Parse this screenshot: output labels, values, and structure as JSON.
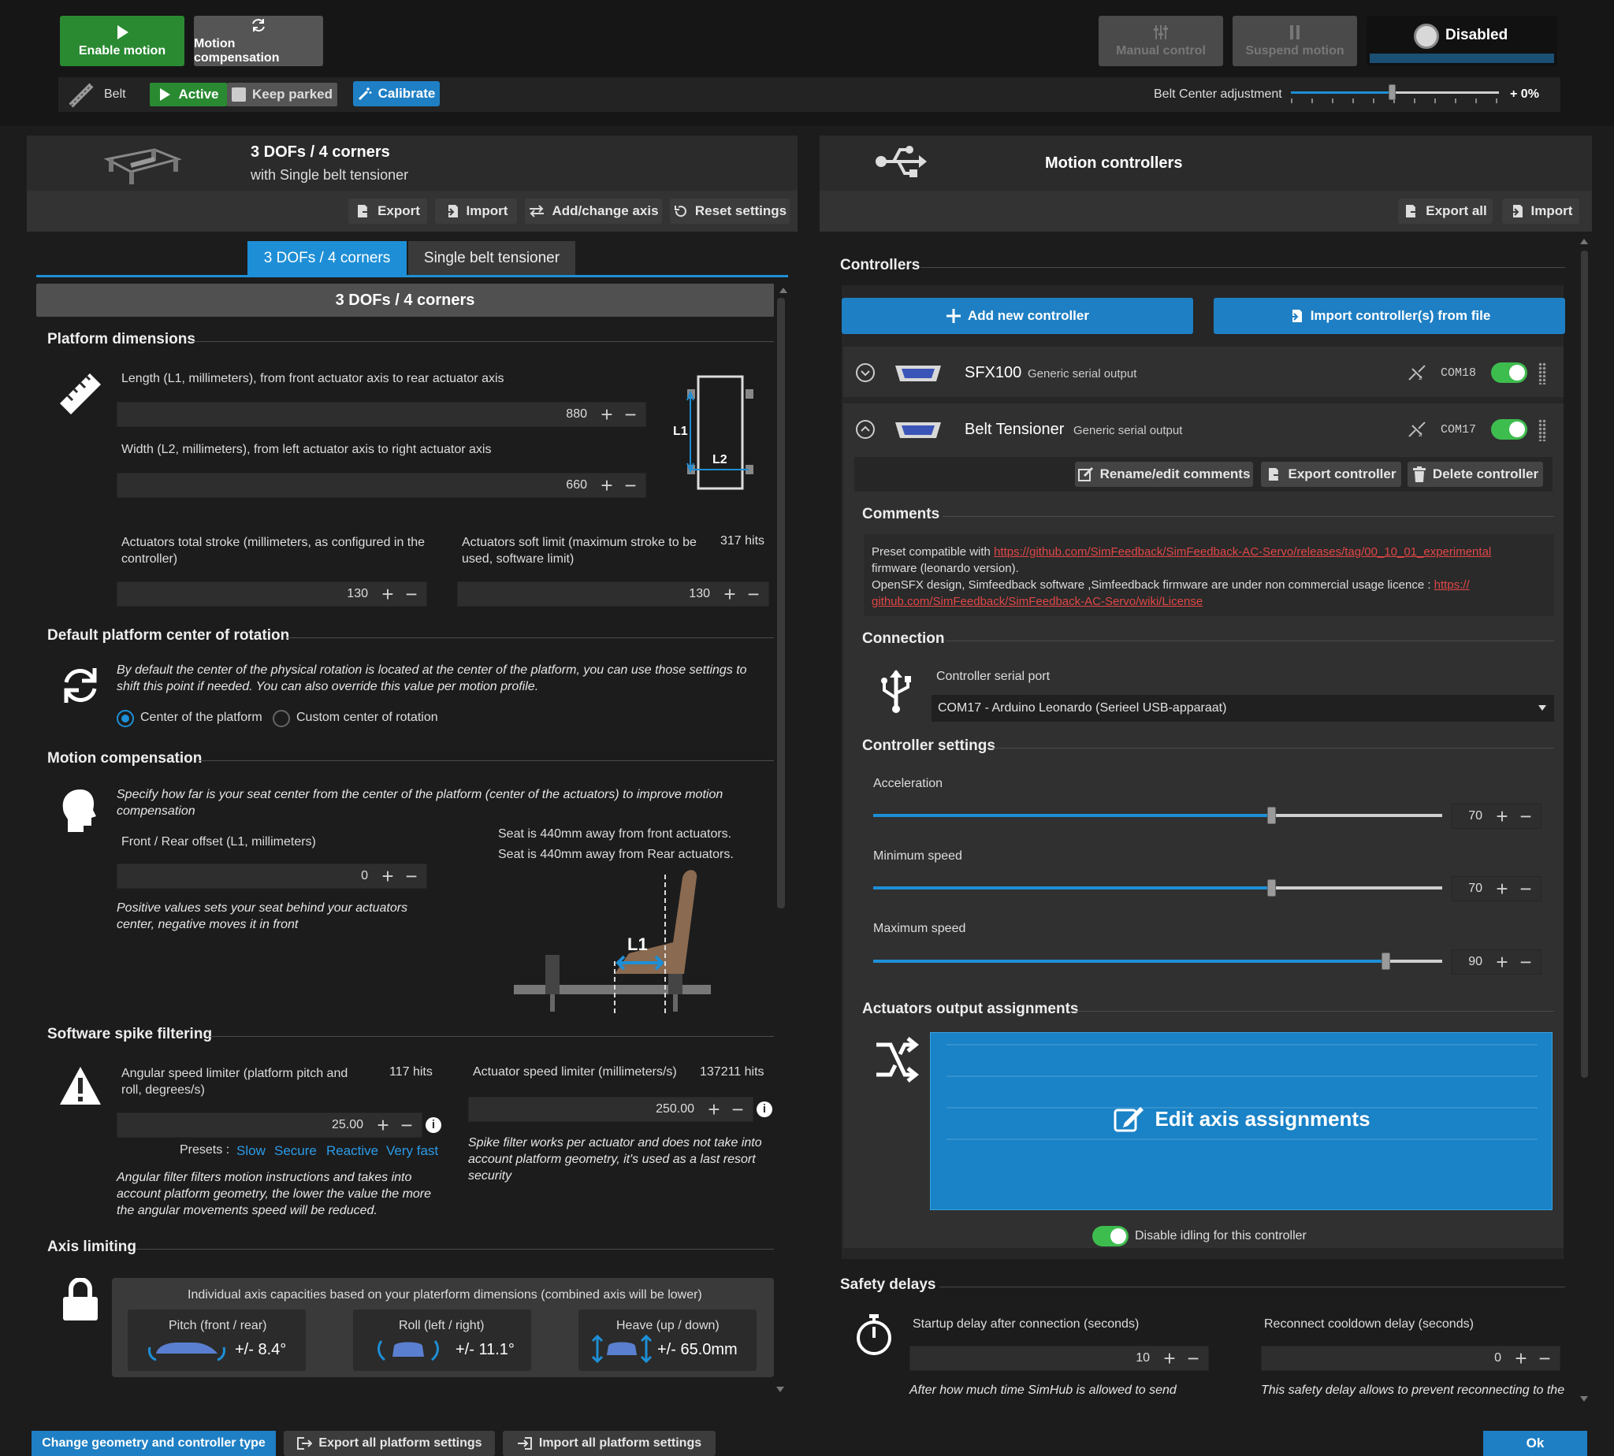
{
  "toolbar": {
    "enable_motion": "Enable motion",
    "motion_compensation": "Motion compensation",
    "manual_control": "Manual control",
    "suspend_motion": "Suspend motion",
    "disabled": "Disabled"
  },
  "belt": {
    "label": "Belt",
    "active": "Active",
    "keep_parked": "Keep parked",
    "calibrate": "Calibrate",
    "center_label": "Belt Center adjustment",
    "center_value": "+ 0%"
  },
  "left_header": {
    "title": "3 DOFs / 4 corners",
    "subtitle": "with Single belt tensioner",
    "export": "Export",
    "import": "Import",
    "add_change_axis": "Add/change axis",
    "reset_settings": "Reset settings"
  },
  "tabs": [
    "3 DOFs / 4 corners",
    "Single belt tensioner"
  ],
  "section_title": "3 DOFs / 4 corners",
  "platform": {
    "heading": "Platform dimensions",
    "length_label": "Length (L1, millimeters), from front actuator axis to rear actuator axis",
    "length_value": "880",
    "width_label": "Width (L2, millimeters), from left actuator axis to right actuator axis",
    "width_value": "660",
    "l1": "L1",
    "l2": "L2",
    "stroke_label": "Actuators total stroke (millimeters, as configured in the controller)",
    "stroke_value": "130",
    "soft_label": "Actuators soft limit (maximum stroke to be used, software limit)",
    "soft_hits": "317 hits",
    "soft_value": "130"
  },
  "rotation": {
    "heading": "Default platform center of rotation",
    "desc": "By default the center of the physical rotation is located at the center of the platform, you can use those settings to shift this point if needed. You can also override this value per motion profile.",
    "opt1": "Center of the platform",
    "opt2": "Custom center of rotation"
  },
  "motion_comp": {
    "heading": "Motion compensation",
    "desc": "Specify how far is your seat center from the center of the platform (center of the actuators) to improve motion compensation",
    "offset_label": "Front / Rear offset (L1, millimeters)",
    "offset_value": "0",
    "note": "Positive values sets your seat behind your actuators center, negative moves it in front",
    "info1": "Seat is 440mm away from front actuators.",
    "info2": "Seat is 440mm away from Rear actuators.",
    "l1": "L1"
  },
  "spike": {
    "heading": "Software spike filtering",
    "angular_label": "Angular speed limiter (platform pitch and roll, degrees/s)",
    "angular_hits": "117 hits",
    "angular_value": "25.00",
    "presets_label": "Presets :",
    "presets": [
      "Slow",
      "Secure",
      "Reactive",
      "Very fast"
    ],
    "angular_note": "Angular filter filters motion instructions and takes into account platform geometry, the lower the value the more the angular movements speed will be reduced.",
    "actuator_label": "Actuator speed limiter (millimeters/s)",
    "actuator_hits": "137211 hits",
    "actuator_value": "250.00",
    "actuator_note": "Spike filter works per actuator and does not take into account platform geometry, it's used as a last resort security"
  },
  "axis_limit": {
    "heading": "Axis limiting",
    "desc": "Individual axis capacities based on your platerform dimensions (combined axis will be lower)",
    "pitch_label": "Pitch (front / rear)",
    "pitch_value": "+/- 8.4°",
    "roll_label": "Roll (left / right)",
    "roll_value": "+/- 11.1°",
    "heave_label": "Heave (up / down)",
    "heave_value": "+/- 65.0mm"
  },
  "bottom": {
    "change_geometry": "Change geometry and controller type",
    "export_all": "Export all platform settings",
    "import_all": "Import all platform settings",
    "ok": "Ok"
  },
  "right_header": {
    "title": "Motion controllers",
    "export_all": "Export all",
    "import": "Import"
  },
  "controllers": {
    "heading": "Controllers",
    "add": "Add new controller",
    "import_file": "Import controller(s) from file",
    "items": [
      {
        "name": "SFX100",
        "type": "Generic serial output",
        "port": "COM18"
      },
      {
        "name": "Belt Tensioner",
        "type": "Generic serial output",
        "port": "COM17"
      }
    ],
    "rename": "Rename/edit comments",
    "export_ctrl": "Export controller",
    "delete_ctrl": "Delete controller"
  },
  "comments": {
    "heading": "Comments",
    "pre": "Preset compatible with ",
    "link1": "https://github.com/SimFeedback/SimFeedback-AC-Servo/releases/tag/00_10_01_experimental",
    "line2": "firmware (leonardo version).",
    "line3": "OpenSFX design, Simfeedback software ,Simfeedback firmware are under non commercial usage licence : ",
    "link2a": "https://",
    "link2b": "github.com/SimFeedback/SimFeedback-AC-Servo/wiki/License"
  },
  "connection": {
    "heading": "Connection",
    "port_label": "Controller serial port",
    "port_value": "COM17 - Arduino Leonardo (Serieel USB-apparaat)"
  },
  "ctrl_settings": {
    "heading": "Controller settings",
    "items": [
      {
        "label": "Acceleration",
        "value": "70",
        "level": 0.7
      },
      {
        "label": "Minimum speed",
        "value": "70",
        "level": 0.7
      },
      {
        "label": "Maximum speed",
        "value": "90",
        "level": 0.9
      }
    ]
  },
  "assign": {
    "heading": "Actuators output assignments",
    "edit": "Edit axis assignments",
    "idle": "Disable idling for this controller"
  },
  "safety": {
    "heading": "Safety delays",
    "startup_label": "Startup delay after connection (seconds)",
    "startup_value": "10",
    "startup_note": "After how much time SimHub is allowed to send",
    "reconnect_label": "Reconnect cooldown delay (seconds)",
    "reconnect_value": "0",
    "reconnect_note": "This safety delay allows to prevent reconnecting to the"
  },
  "colors": {
    "accent": "#1e8fd6",
    "green": "#27a843",
    "link": "#e04747"
  }
}
